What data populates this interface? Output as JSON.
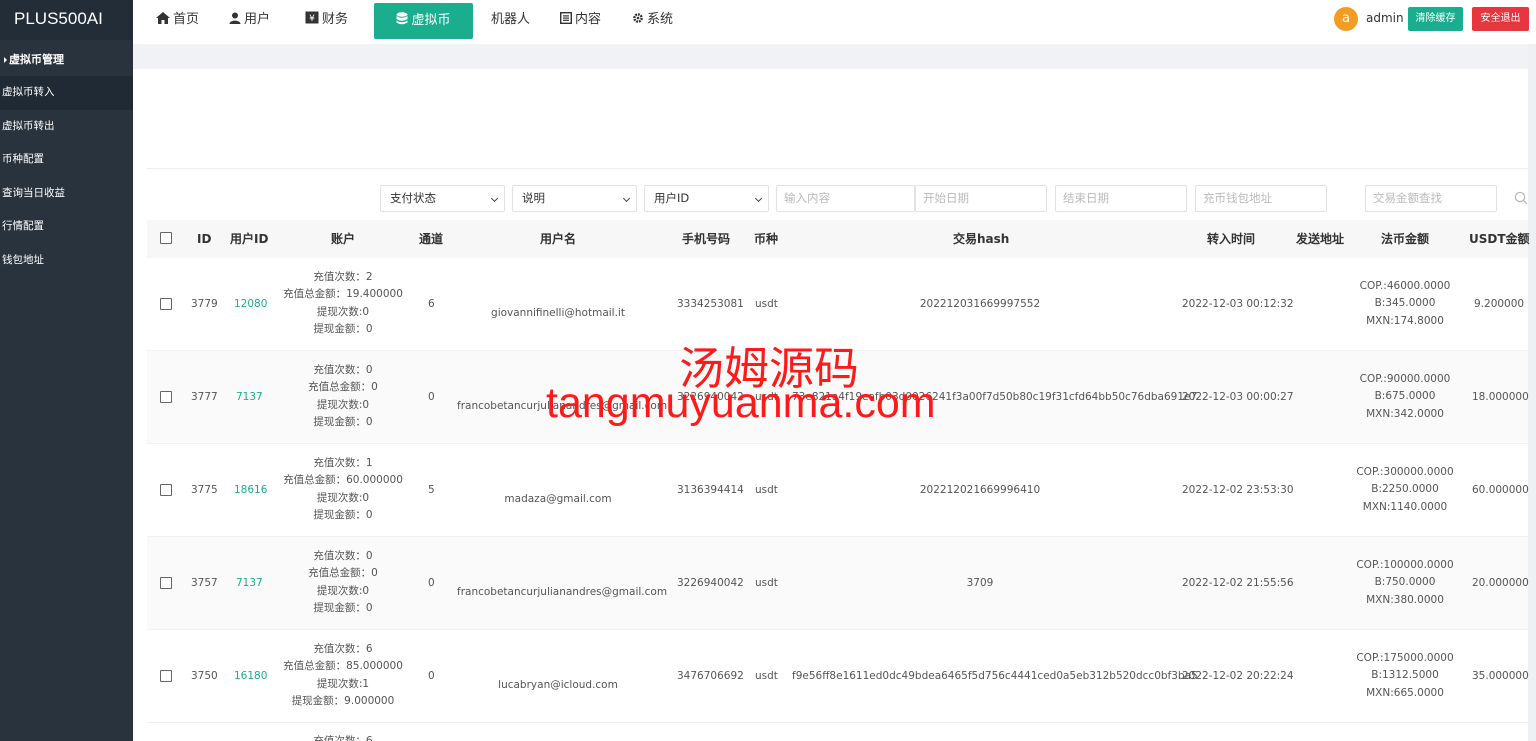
{
  "sidebar": {
    "logo": "PLUS500AI",
    "group": "虚拟币管理",
    "items": [
      {
        "label": "虚拟币转入",
        "active": true
      },
      {
        "label": "虚拟币转出",
        "active": false
      },
      {
        "label": "币种配置",
        "active": false
      },
      {
        "label": "查询当日收益",
        "active": false
      },
      {
        "label": "行情配置",
        "active": false
      },
      {
        "label": "钱包地址",
        "active": false
      }
    ]
  },
  "topnav": {
    "items": [
      {
        "label": "首页",
        "icon": "home-icon"
      },
      {
        "label": "用户",
        "icon": "user-icon"
      },
      {
        "label": "财务",
        "icon": "finance-icon"
      },
      {
        "label": "虚拟币",
        "icon": "database-icon",
        "active": true
      },
      {
        "label": "机器人",
        "icon": ""
      },
      {
        "label": "内容",
        "icon": "content-icon"
      },
      {
        "label": "系统",
        "icon": "gear-icon"
      }
    ],
    "avatar_letter": "a",
    "admin": "admin",
    "clear_cache": "清除缓存",
    "logout": "安全退出"
  },
  "filters": {
    "pay_status": "支付状态",
    "remark": "说明",
    "user_id": "用户ID",
    "content_placeholder": "输入内容",
    "start_placeholder": "开始日期",
    "end_placeholder": "结束日期",
    "wallet_placeholder": "充币钱包地址",
    "amount_placeholder": "交易金额查找"
  },
  "table": {
    "headers": [
      "ID",
      "用户ID",
      "账户",
      "通道",
      "用户名",
      "手机号码",
      "币种",
      "交易hash",
      "转入时间",
      "发送地址",
      "法币金额",
      "USDT金额"
    ],
    "rows": [
      {
        "id": "3779",
        "uid": "12080",
        "account": [
          "充值次数：2",
          "充值总金额：19.400000",
          "提现次数:0",
          "提现金额：0"
        ],
        "channel": "6",
        "username": "giovannifinelli@hotmail.it",
        "phone": "3334253081",
        "coin": "usdt",
        "hash": "202212031669997552",
        "time": "2022-12-03 00:12:32",
        "fiat": [
          "COP.:46000.0000",
          "B:345.0000",
          "MXN:174.8000"
        ],
        "usdt": "9.200000"
      },
      {
        "id": "3777",
        "uid": "7137",
        "account": [
          "充值次数：0",
          "充值总金额：0",
          "提现次数:0",
          "提现金额：0"
        ],
        "channel": "0",
        "username": "francobetancurjulianandres@gmail.com",
        "phone": "3226940042",
        "coin": "usdt",
        "hash": "73e821a4f19eafb03d0026241f3a00f7d50b80c19f31cfd64bb50c76dba691e7",
        "time": "2022-12-03 00:00:27",
        "fiat": [
          "COP.:90000.0000",
          "B:675.0000",
          "MXN:342.0000"
        ],
        "usdt": "18.000000"
      },
      {
        "id": "3775",
        "uid": "18616",
        "account": [
          "充值次数：1",
          "充值总金额：60.000000",
          "提现次数:0",
          "提现金额：0"
        ],
        "channel": "5",
        "username": "madaza@gmail.com",
        "phone": "3136394414",
        "coin": "usdt",
        "hash": "202212021669996410",
        "time": "2022-12-02 23:53:30",
        "fiat": [
          "COP.:300000.0000",
          "B:2250.0000",
          "MXN:1140.0000"
        ],
        "usdt": "60.000000"
      },
      {
        "id": "3757",
        "uid": "7137",
        "account": [
          "充值次数：0",
          "充值总金额：0",
          "提现次数:0",
          "提现金额：0"
        ],
        "channel": "0",
        "username": "francobetancurjulianandres@gmail.com",
        "phone": "3226940042",
        "coin": "usdt",
        "hash": "3709",
        "time": "2022-12-02 21:55:56",
        "fiat": [
          "COP.:100000.0000",
          "B:750.0000",
          "MXN:380.0000"
        ],
        "usdt": "20.000000"
      },
      {
        "id": "3750",
        "uid": "16180",
        "account": [
          "充值次数：6",
          "充值总金额：85.000000",
          "提现次数:1",
          "提现金额：9.000000"
        ],
        "channel": "0",
        "username": "lucabryan@icloud.com",
        "phone": "3476706692",
        "coin": "usdt",
        "hash": "f9e56ff8e1611ed0dc49bdea6465f5d756c4441ced0a5eb312b520dcc0bf3ba5",
        "time": "2022-12-02 20:22:24",
        "fiat": [
          "COP.:175000.0000",
          "B:1312.5000",
          "MXN:665.0000"
        ],
        "usdt": "35.000000"
      }
    ],
    "partial_row_first_line": "充值次数：6"
  },
  "watermark": {
    "cn": "汤姆源码",
    "en": "tangmuyuanma.com"
  }
}
